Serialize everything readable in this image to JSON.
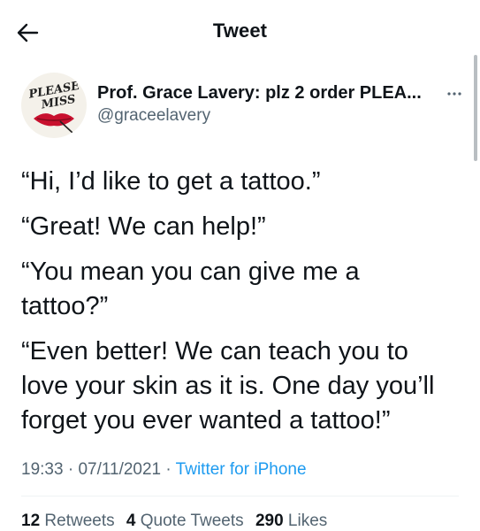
{
  "header": {
    "title": "Tweet",
    "back_icon": "back-arrow-icon"
  },
  "author": {
    "avatar_text_line1": "PLEASE",
    "avatar_text_line2": "MISS",
    "name": "Prof. Grace Lavery: plz 2 order PLEA...",
    "handle": "@graceelavery",
    "more_icon": "more-dots-icon"
  },
  "tweet": {
    "paragraphs": [
      "“Hi, I’d like to get a tattoo.”",
      "“Great! We can help!”",
      "“You mean you can give me a tattoo?”",
      "“Even better! We can teach you to love your skin as it is. One day you’ll forget you ever wanted a tattoo!”"
    ]
  },
  "meta": {
    "time": "19:33",
    "separator": "·",
    "date": "07/11/2021",
    "source": "Twitter for iPhone"
  },
  "stats": {
    "retweets_count": "12",
    "retweets_label": "Retweets",
    "quotes_count": "4",
    "quotes_label": "Quote Tweets",
    "likes_count": "290",
    "likes_label": "Likes"
  },
  "colors": {
    "text": "#0f1419",
    "secondary": "#536471",
    "link": "#1d9bf0",
    "lips": "#c8102e"
  }
}
